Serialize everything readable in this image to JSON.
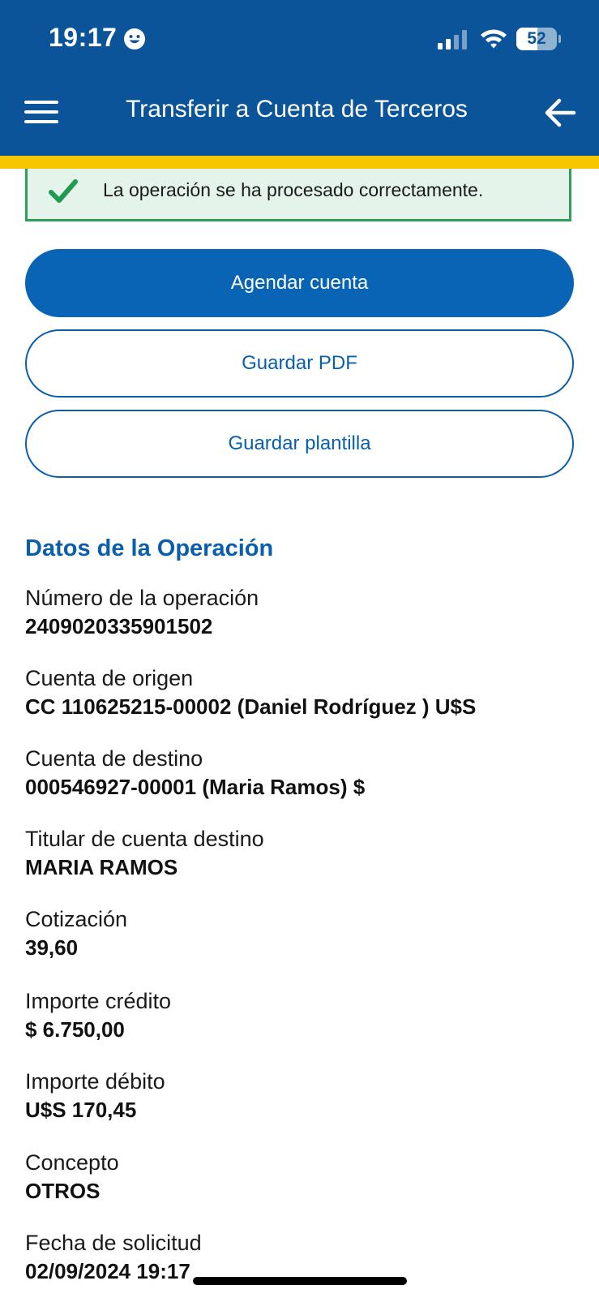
{
  "status_bar": {
    "time": "19:17",
    "battery_level": "52",
    "battery_fraction": 0.52,
    "signal_bars_active": 2,
    "icons": [
      "smiley-face-icon",
      "cellular-signal-icon",
      "wifi-icon",
      "battery-icon"
    ]
  },
  "header": {
    "title": "Transferir a Cuenta de Terceros",
    "menu_icon": "hamburger-menu-icon",
    "back_icon": "arrow-left-icon",
    "background_color": "#0b5499",
    "accent_color": "#f7c600"
  },
  "success_banner": {
    "icon": "checkmark-icon",
    "message": "La operación se ha procesado correctamente.",
    "color": "#2f9f57"
  },
  "actions": {
    "schedule_account": "Agendar cuenta",
    "save_pdf": "Guardar PDF",
    "save_template": "Guardar plantilla",
    "primary_color": "#0a64b5"
  },
  "details": {
    "section_title": "Datos de la Operación",
    "items": [
      {
        "label": "Número de la operación",
        "value": "2409020335901502"
      },
      {
        "label": "Cuenta de origen",
        "value": "CC 110625215-00002 (Daniel Rodríguez ) U$S"
      },
      {
        "label": "Cuenta de destino",
        "value": "000546927-00001 (Maria Ramos) $"
      },
      {
        "label": "Titular de cuenta destino",
        "value": "MARIA RAMOS"
      },
      {
        "label": "Cotización",
        "value": "39,60"
      },
      {
        "label": "Importe crédito",
        "value": "$ 6.750,00"
      },
      {
        "label": "Importe débito",
        "value": "U$S 170,45"
      },
      {
        "label": "Concepto",
        "value": "OTROS"
      },
      {
        "label": "Fecha de solicitud",
        "value": "02/09/2024 19:17"
      }
    ]
  }
}
